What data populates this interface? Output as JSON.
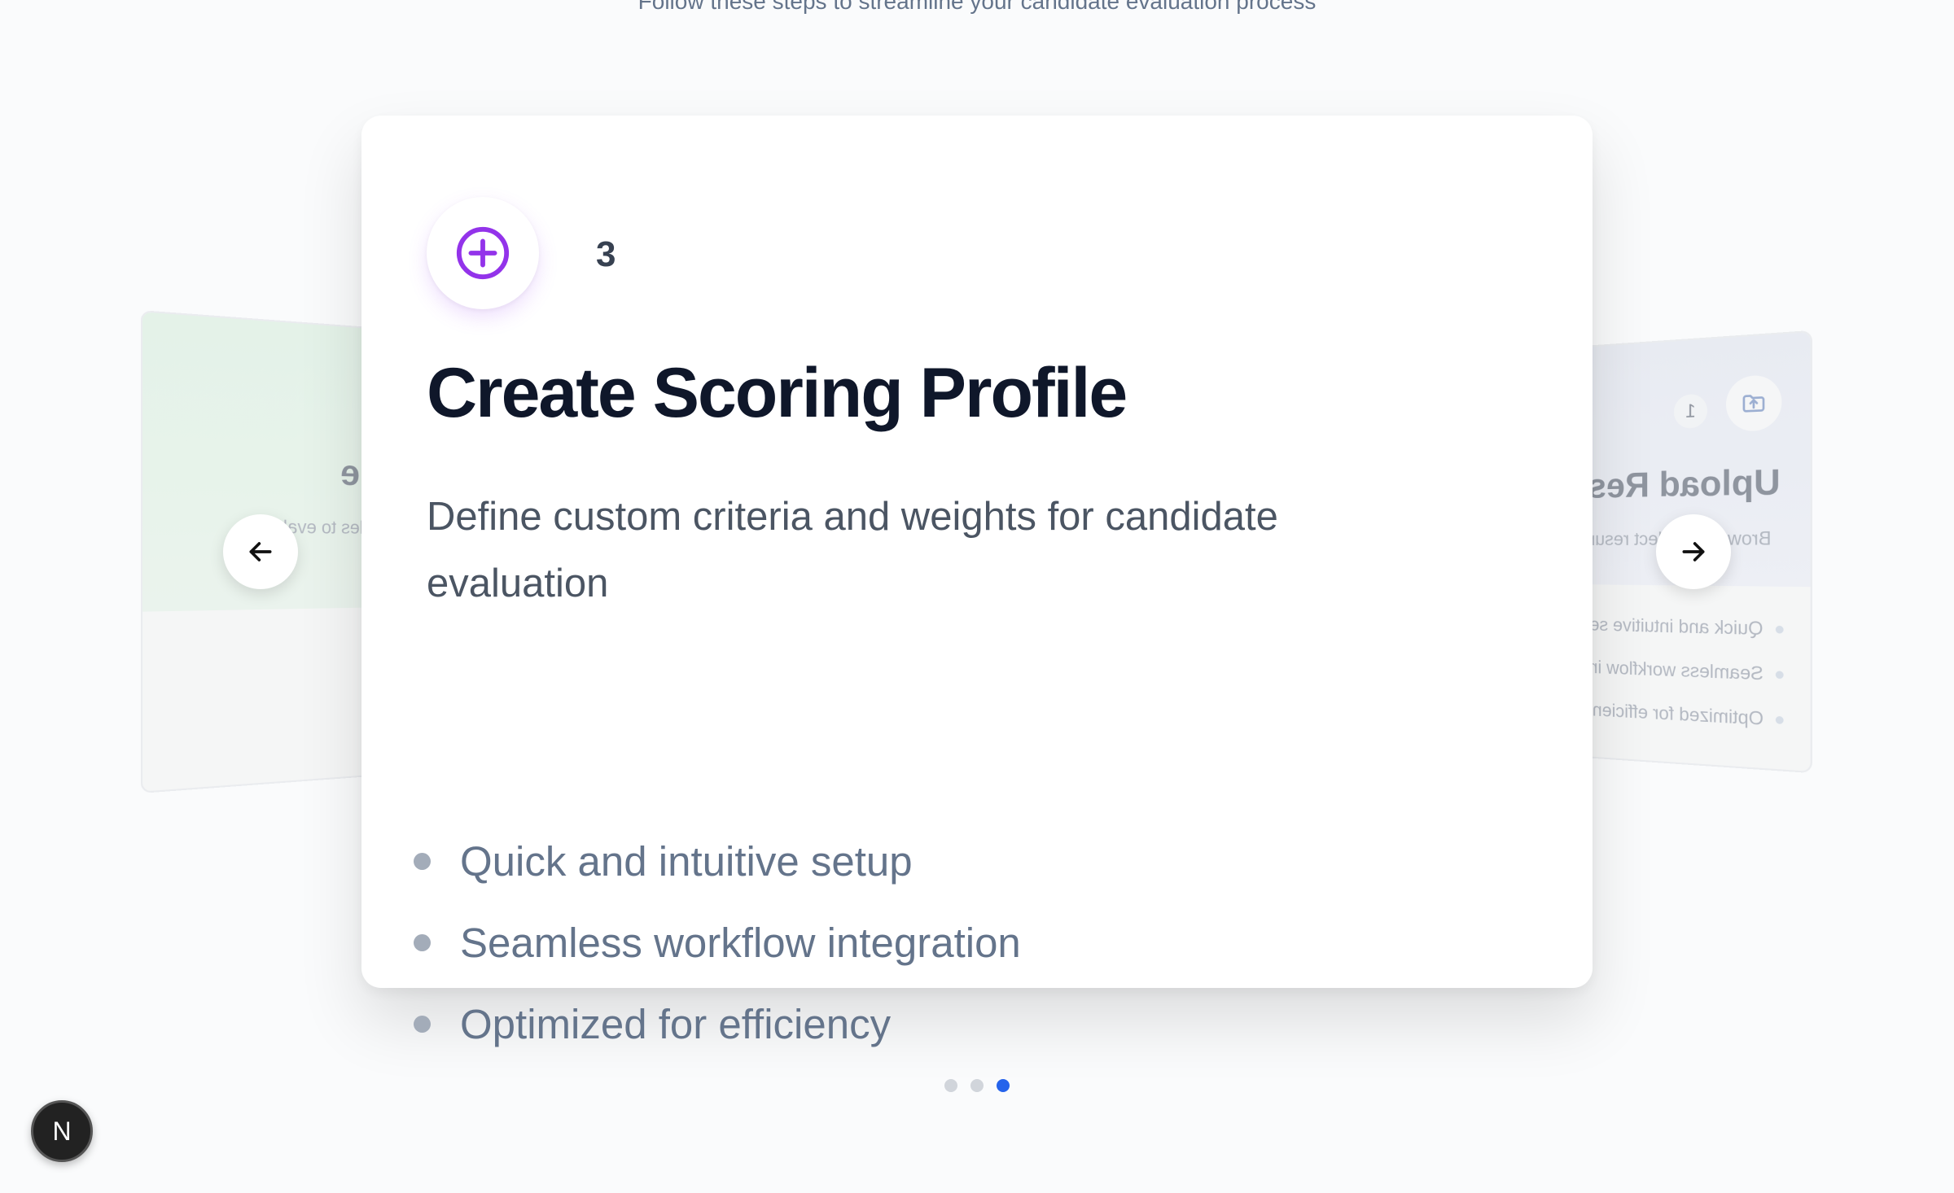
{
  "header": {
    "subtitle": "Follow these steps to streamline your candidate evaluation process"
  },
  "carousel": {
    "active_index": 3,
    "left_card": {
      "title_fragment": "e",
      "desc_fragment": "iles to eval"
    },
    "main_card": {
      "icon": "plus-circle-icon",
      "step_number": "3",
      "title": "Create Scoring Profile",
      "description": "Define custom criteria and weights for candidate evaluation",
      "features": [
        "Quick and intuitive setup",
        "Seamless workflow integration",
        "Optimized for efficiency"
      ]
    },
    "right_card": {
      "icon": "upload-folder-icon",
      "step_number": "1",
      "title": "Upload Resume",
      "description": "Browse or select resumes",
      "features": [
        "Quick and intuitive setup",
        "Seamless workflow integration",
        "Optimized for efficiency"
      ]
    },
    "pagination": {
      "count": 3,
      "active": 3
    }
  },
  "badge": {
    "label": "N"
  },
  "colors": {
    "accent": "#9333ea",
    "active_dot": "#2563eb",
    "inactive_dot": "#d1d5db"
  }
}
